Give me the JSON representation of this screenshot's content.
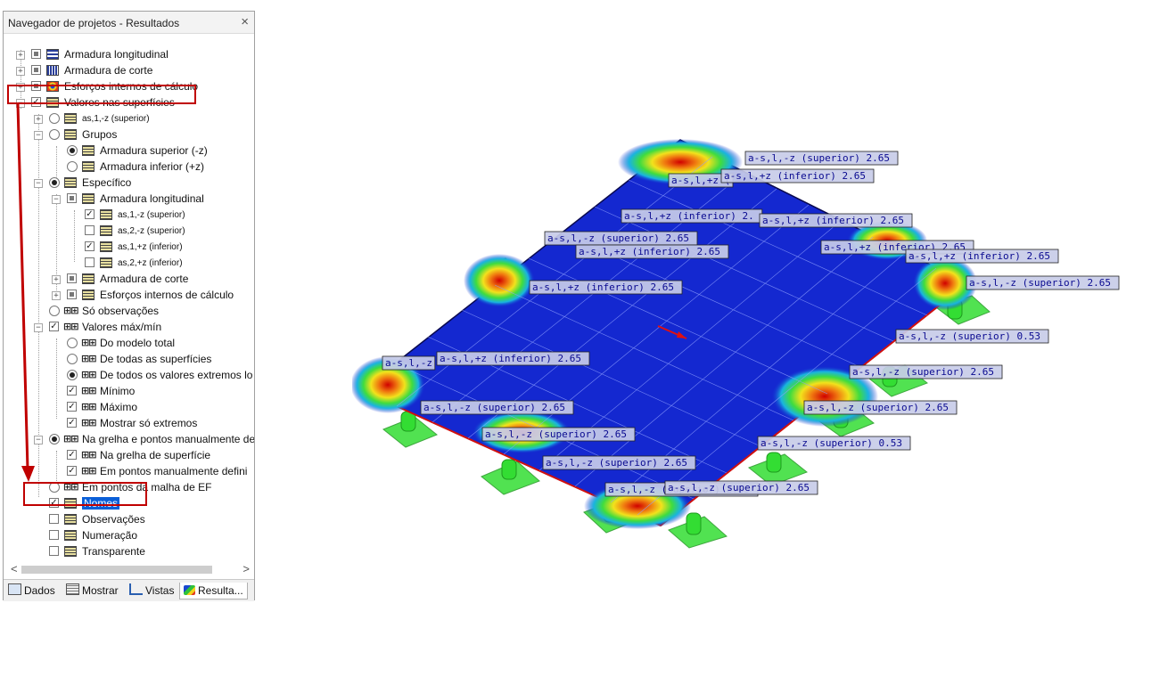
{
  "panel": {
    "title": "Navegador de projetos - Resultados",
    "close": "×"
  },
  "tree": [
    {
      "label": "Armadura longitudinal"
    },
    {
      "label": "Armadura de corte"
    },
    {
      "label": "Esforços internos de cálculo"
    },
    {
      "label": "Valores nas superfícies"
    },
    {
      "label": "as,1,-z (superior)"
    },
    {
      "label": "Grupos"
    },
    {
      "label": "Armadura superior (-z)"
    },
    {
      "label": "Armadura inferior (+z)"
    },
    {
      "label": "Específico"
    },
    {
      "label": "Armadura longitudinal"
    },
    {
      "label": "as,1,-z (superior)"
    },
    {
      "label": "as,2,-z (superior)"
    },
    {
      "label": "as,1,+z (inferior)"
    },
    {
      "label": "as,2,+z (inferior)"
    },
    {
      "label": "Armadura de corte"
    },
    {
      "label": "Esforços internos de cálculo"
    },
    {
      "label": "Só observações"
    },
    {
      "label": "Valores máx/mín"
    },
    {
      "label": "Do modelo total"
    },
    {
      "label": "De todas as superfícies"
    },
    {
      "label": "De todos os valores extremos lo"
    },
    {
      "label": "Mínimo"
    },
    {
      "label": "Máximo"
    },
    {
      "label": "Mostrar só extremos"
    },
    {
      "label": "Na grelha e pontos manualmente de"
    },
    {
      "label": "Na grelha de superfície"
    },
    {
      "label": "Em pontos manualmente defini"
    },
    {
      "label": "Em pontos da malha de EF"
    },
    {
      "label": "Nomes"
    },
    {
      "label": "Observações"
    },
    {
      "label": "Numeração"
    },
    {
      "label": "Transparente"
    }
  ],
  "tabs": [
    {
      "label": "Dados",
      "icon": "data-icon"
    },
    {
      "label": "Mostrar",
      "icon": "display-icon"
    },
    {
      "label": "Vistas",
      "icon": "views-icon"
    },
    {
      "label": "Resulta...",
      "icon": "results-icon"
    }
  ],
  "scroll": {
    "left": "<",
    "right": ">"
  },
  "result_labels": [
    "a-s,l,-z (superior)  2.65",
    "a-s,l,+z (",
    "a-s,l,+z (inferior)  2.65",
    "a-s,l,+z (inferior)  2.",
    "a-s,l,+z (inferior)  2.65",
    "a-s,l,-z (superior)  2.65",
    "a-s,l,+z (inferior)  2.65",
    "a-s,l,+z (inferior)  2.65",
    "a-s,l,+z (inferior)  2.65",
    "a-s,l,-z (superior)  2.65",
    "a-s,l,+z (inferior)  2.65",
    "a-s,l,-z (superior)  0.53",
    "a-s,l,-z",
    "a-s,l,+z (inferior)  2.65",
    "a-s,l,-z (superior)  2.65",
    "a-s,l,-z (superior)  2.65",
    "a-s,l,-z (superior)  2.65",
    "a-s,l,-z (superior)  2.65",
    "a-s,l,-z (superior)  2.65",
    "a-s,l,-z (superior)  0.53",
    "a-s,l,-z (superior)  2.65",
    "a-s,l,-z (superior)  2.65"
  ],
  "colors": {
    "highlight": "#c00000",
    "selection": "#0a5fd8",
    "plate": "#1428d0",
    "support": "#33dd33"
  }
}
